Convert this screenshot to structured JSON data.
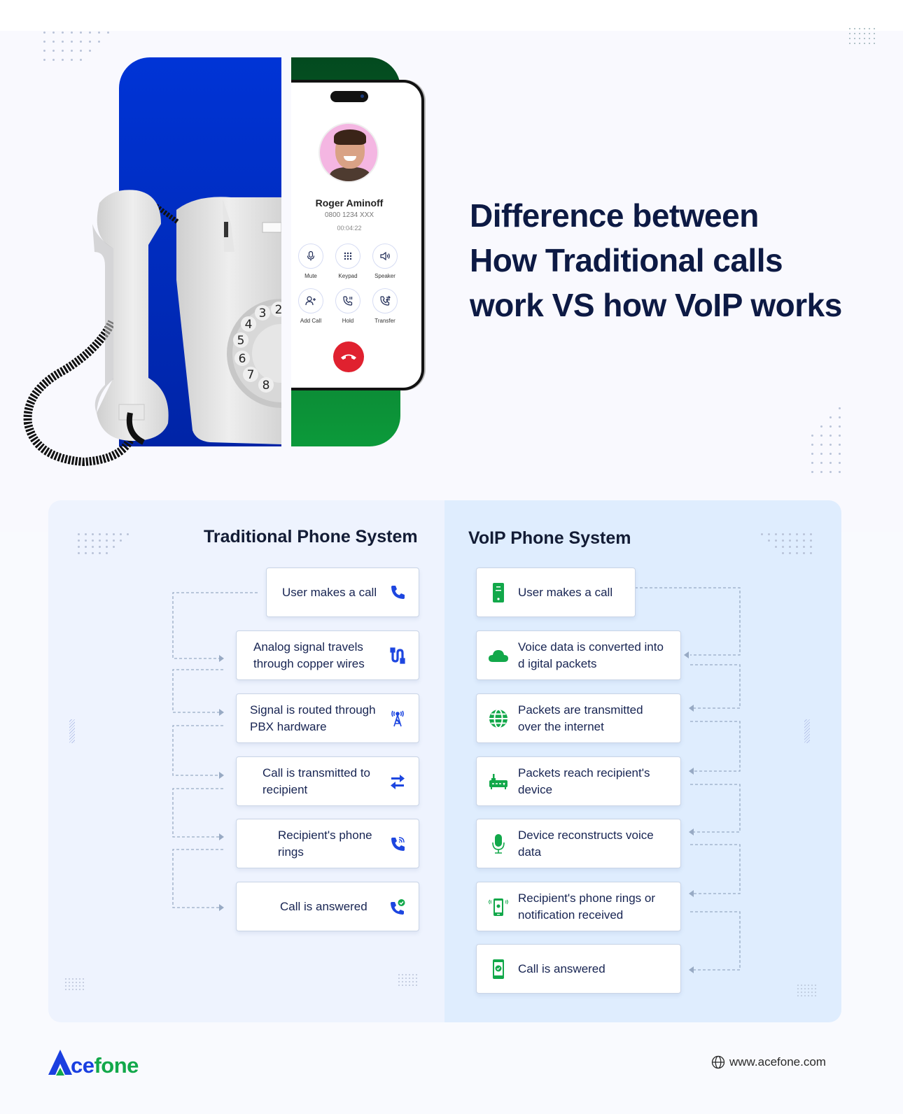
{
  "hero": {
    "title_line1": "Difference between",
    "title_line2_pre": "How ",
    "title_line2_bold": "Traditional calls",
    "title_line3_pre": "work VS how ",
    "title_line3_bold": "VoIP",
    "title_line3_post": " works"
  },
  "phone_screen": {
    "caller_name": "Roger Aminoff",
    "caller_number": "0800 1234 XXX",
    "call_duration": "00:04:22",
    "buttons": [
      {
        "label": "Mute",
        "icon": "microphone-icon"
      },
      {
        "label": "Keypad",
        "icon": "keypad-icon"
      },
      {
        "label": "Speaker",
        "icon": "speaker-icon"
      },
      {
        "label": "Add Call",
        "icon": "add-user-icon"
      },
      {
        "label": "Hold",
        "icon": "hold-icon"
      },
      {
        "label": "Transfer",
        "icon": "transfer-icon"
      }
    ],
    "hangup_icon": "hangup-icon"
  },
  "rotary_dial_digits": [
    "2",
    "3",
    "4",
    "5",
    "6",
    "7",
    "8"
  ],
  "traditional": {
    "title": "Traditional Phone System",
    "steps": [
      {
        "text": "User makes a call",
        "icon": "phone-icon"
      },
      {
        "text": "Analog signal travels through copper wires",
        "icon": "cable-icon"
      },
      {
        "text": "Signal is routed through PBX hardware",
        "icon": "antenna-tower-icon"
      },
      {
        "text": "Call is transmitted to recipient",
        "icon": "transfer-arrows-icon"
      },
      {
        "text": "Recipient's phone rings",
        "icon": "phone-ringing-icon"
      },
      {
        "text": "Call is answered",
        "icon": "phone-check-icon"
      }
    ]
  },
  "voip": {
    "title": "VoIP Phone System",
    "steps": [
      {
        "text": "User makes a call",
        "icon": "mobile-phone-icon"
      },
      {
        "text": "Voice data is converted into d igital packets",
        "icon": "cloud-icon"
      },
      {
        "text": "Packets are transmitted over the internet",
        "icon": "globe-icon"
      },
      {
        "text": "Packets reach recipient's device",
        "icon": "router-icon"
      },
      {
        "text": "Device reconstructs voice data",
        "icon": "microphone-icon"
      },
      {
        "text": "Recipient's phone rings or notification received",
        "icon": "mobile-ringing-icon"
      },
      {
        "text": "Call is answered",
        "icon": "mobile-check-icon"
      }
    ]
  },
  "colors": {
    "brand_blue": "#1a3fe0",
    "brand_green": "#12a84a",
    "hangup_red": "#e0212f",
    "heading_navy": "#0d1a44"
  },
  "footer": {
    "logo_prefix": "A",
    "logo_part1": "ce",
    "logo_part2": "fone",
    "website": "www.acefone.com"
  }
}
